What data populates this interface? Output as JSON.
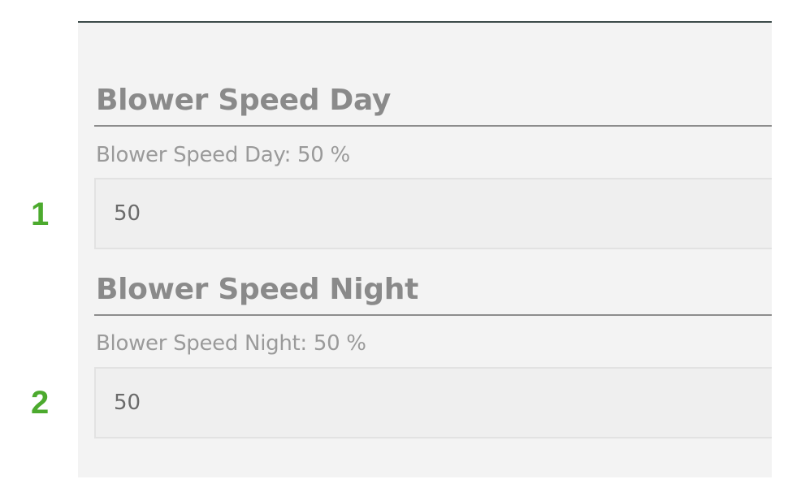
{
  "callouts": {
    "day": "1",
    "night": "2"
  },
  "blower_day": {
    "heading": "Blower Speed Day",
    "label": "Blower Speed Day: 50 %",
    "value": "50"
  },
  "blower_night": {
    "heading": "Blower Speed Night",
    "label": "Blower Speed Night: 50 %",
    "value": "50"
  },
  "colors": {
    "callout": "#4caa2e",
    "heading": "#8a8a8a",
    "panel_background": "#f3f3f3",
    "panel_top_border": "#3b4a48"
  }
}
